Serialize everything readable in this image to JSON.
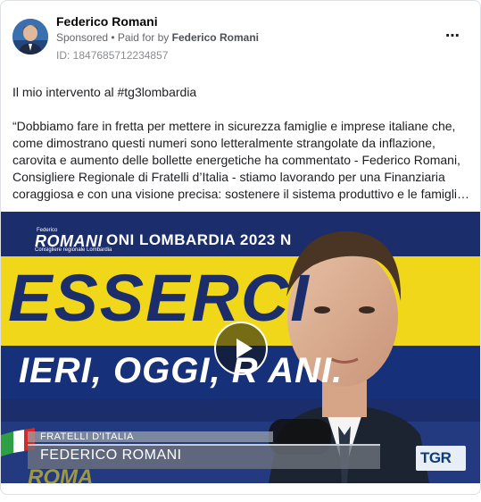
{
  "post": {
    "page_name": "Federico Romani",
    "sponsored_label": "Sponsored",
    "separator": " • ",
    "paid_prefix": "Paid for by ",
    "paid_by": "Federico Romani",
    "ad_id": "ID: 1847685712234857",
    "more_icon": "⋯",
    "intro": "Il mio intervento al #tg3lombardia",
    "quote": "“Dobbiamo fare in fretta per mettere in sicurezza famiglie e imprese italiane che, come dimostrano questi numeri sono letteralmente strangolate da inflazione, carovita e aumento delle bollette energetiche ha commentato - Federico Romani, Consigliere Regionale di Fratelli d’Italia - stiamo lavorando per una Finanziaria coraggiosa e con una visione precisa: sostenere il sistema produttivo e le famiglie italiane…"
  },
  "video": {
    "logo_top": "Federico",
    "logo_name": "ROMANI",
    "logo_sub": "Consigliere regionale Lombardia",
    "banner_top": "ONI LOMBARDIA 2023 N",
    "banner_big": "ESSERCI",
    "banner_mid": "IERI, OGGI, R   ANI.",
    "lower_third_party": "FRATELLI D'ITALIA",
    "lower_third_name": "FEDERICO ROMANI",
    "broadcaster_logo": "TGR",
    "background_word": "ROMA",
    "play_icon": "play-icon"
  },
  "colors": {
    "brand_blue": "#1b2d6b",
    "banner_yellow": "#f0d71a",
    "muted_text": "#65676b"
  }
}
